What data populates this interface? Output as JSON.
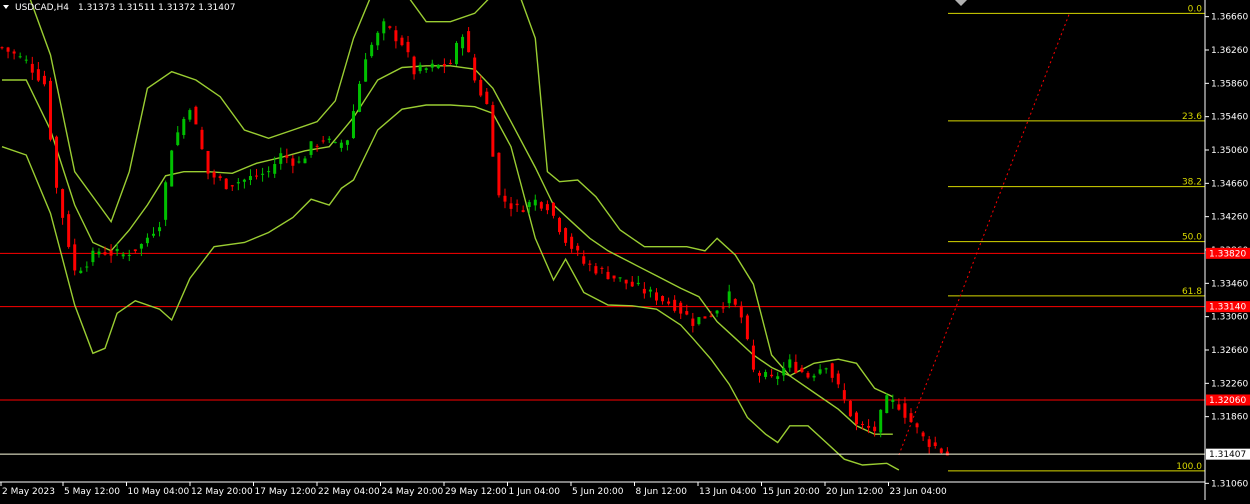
{
  "header": {
    "symbol_text": "USDCAD,H4",
    "ohlc_text": "1.31373 1.31511 1.31372 1.31407"
  },
  "colors": {
    "background": "#000000",
    "bull": "#00c000",
    "bear": "#ff0000",
    "band": "#9acd32",
    "fib": "#d8d800",
    "resistance_line": "#ff0000",
    "current_price_line": "#ffffe0",
    "price_tag_red": "#ff0000",
    "projection": "#ff0000",
    "axis_text": "#ffffff",
    "price_tag_current_bg": "#ffffff"
  },
  "chart_data": {
    "type": "candlestick",
    "y_range": [
      1.3086,
      1.3686
    ],
    "y_ticks": [
      "1.36660",
      "1.36260",
      "1.35860",
      "1.35460",
      "1.35060",
      "1.34660",
      "1.34260",
      "1.33860",
      "1.33460",
      "1.33060",
      "1.32660",
      "1.32260",
      "1.31860",
      "1.31060"
    ],
    "x_labels": [
      "2 May 2023",
      "5 May 12:00",
      "10 May 04:00",
      "12 May 20:00",
      "17 May 12:00",
      "22 May 04:00",
      "24 May 20:00",
      "29 May 12:00",
      "1 Jun 04:00",
      "5 Jun 20:00",
      "8 Jun 12:00",
      "13 Jun 04:00",
      "15 Jun 20:00",
      "20 Jun 12:00",
      "23 Jun 04:00"
    ],
    "close_path": [
      [
        0,
        1.3629
      ],
      [
        4,
        1.3612
      ],
      [
        7,
        1.3586
      ],
      [
        9,
        1.346
      ],
      [
        12,
        1.336
      ],
      [
        16,
        1.3385
      ],
      [
        20,
        1.338
      ],
      [
        23,
        1.3392
      ],
      [
        26,
        1.342
      ],
      [
        28,
        1.351
      ],
      [
        31,
        1.356
      ],
      [
        34,
        1.3478
      ],
      [
        37,
        1.3465
      ],
      [
        40,
        1.347
      ],
      [
        44,
        1.348
      ],
      [
        46,
        1.35
      ],
      [
        49,
        1.349
      ],
      [
        51,
        1.351
      ],
      [
        53,
        1.352
      ],
      [
        55,
        1.351
      ],
      [
        57,
        1.352
      ],
      [
        60,
        1.362
      ],
      [
        63,
        1.3655
      ],
      [
        66,
        1.3635
      ],
      [
        68,
        1.36
      ],
      [
        71,
        1.3605
      ],
      [
        74,
        1.361
      ],
      [
        76,
        1.3648
      ],
      [
        78,
        1.359
      ],
      [
        80,
        1.356
      ],
      [
        82,
        1.345
      ],
      [
        85,
        1.3435
      ],
      [
        88,
        1.3445
      ],
      [
        90,
        1.344
      ],
      [
        93,
        1.34
      ],
      [
        96,
        1.337
      ],
      [
        99,
        1.336
      ],
      [
        102,
        1.335
      ],
      [
        105,
        1.334
      ],
      [
        108,
        1.333
      ],
      [
        111,
        1.332
      ],
      [
        114,
        1.33
      ],
      [
        117,
        1.331
      ],
      [
        120,
        1.333
      ],
      [
        122,
        1.3305
      ],
      [
        124,
        1.324
      ],
      [
        127,
        1.323
      ],
      [
        130,
        1.325
      ],
      [
        133,
        1.3235
      ],
      [
        136,
        1.325
      ],
      [
        138,
        1.322
      ],
      [
        141,
        1.3175
      ],
      [
        144,
        1.317
      ],
      [
        146,
        1.3205
      ],
      [
        148,
        1.32
      ],
      [
        150,
        1.318
      ],
      [
        152,
        1.316
      ],
      [
        154,
        1.315
      ],
      [
        156,
        1.3141
      ]
    ],
    "bollinger": {
      "upper": [
        [
          0,
          1.37
        ],
        [
          4,
          1.37
        ],
        [
          8,
          1.362
        ],
        [
          12,
          1.348
        ],
        [
          16,
          1.344
        ],
        [
          18,
          1.342
        ],
        [
          21,
          1.348
        ],
        [
          24,
          1.358
        ],
        [
          28,
          1.36
        ],
        [
          32,
          1.359
        ],
        [
          36,
          1.357
        ],
        [
          40,
          1.353
        ],
        [
          44,
          1.352
        ],
        [
          48,
          1.353
        ],
        [
          52,
          1.354
        ],
        [
          55,
          1.3565
        ],
        [
          58,
          1.364
        ],
        [
          62,
          1.371
        ],
        [
          66,
          1.37
        ],
        [
          70,
          1.366
        ],
        [
          74,
          1.366
        ],
        [
          78,
          1.367
        ],
        [
          82,
          1.37
        ],
        [
          85,
          1.37
        ],
        [
          88,
          1.364
        ],
        [
          90,
          1.348
        ],
        [
          92,
          1.3468
        ],
        [
          95,
          1.347
        ],
        [
          98,
          1.345
        ],
        [
          102,
          1.341
        ],
        [
          106,
          1.339
        ],
        [
          110,
          1.339
        ],
        [
          113,
          1.339
        ],
        [
          116,
          1.3385
        ],
        [
          118,
          1.34
        ],
        [
          121,
          1.338
        ],
        [
          124,
          1.3345
        ],
        [
          127,
          1.326
        ],
        [
          130,
          1.3235
        ],
        [
          134,
          1.325
        ],
        [
          138,
          1.3255
        ],
        [
          141,
          1.325
        ],
        [
          144,
          1.322
        ],
        [
          147,
          1.321
        ]
      ],
      "middle": [
        [
          0,
          1.359
        ],
        [
          4,
          1.359
        ],
        [
          8,
          1.353
        ],
        [
          12,
          1.344
        ],
        [
          15,
          1.3395
        ],
        [
          18,
          1.3385
        ],
        [
          21,
          1.341
        ],
        [
          24,
          1.344
        ],
        [
          27,
          1.3475
        ],
        [
          30,
          1.348
        ],
        [
          34,
          1.348
        ],
        [
          38,
          1.3478
        ],
        [
          42,
          1.349
        ],
        [
          46,
          1.3497
        ],
        [
          50,
          1.3505
        ],
        [
          54,
          1.351
        ],
        [
          58,
          1.3545
        ],
        [
          62,
          1.359
        ],
        [
          66,
          1.3605
        ],
        [
          70,
          1.3607
        ],
        [
          74,
          1.3607
        ],
        [
          78,
          1.3603
        ],
        [
          81,
          1.358
        ],
        [
          84,
          1.354
        ],
        [
          88,
          1.3485
        ],
        [
          91,
          1.344
        ],
        [
          94,
          1.342
        ],
        [
          97,
          1.34
        ],
        [
          100,
          1.3385
        ],
        [
          104,
          1.337
        ],
        [
          108,
          1.3355
        ],
        [
          112,
          1.334
        ],
        [
          115,
          1.333
        ],
        [
          118,
          1.33
        ],
        [
          121,
          1.328
        ],
        [
          124,
          1.326
        ],
        [
          127,
          1.3245
        ],
        [
          130,
          1.3235
        ],
        [
          134,
          1.3215
        ],
        [
          138,
          1.3195
        ],
        [
          141,
          1.3175
        ],
        [
          144,
          1.3165
        ],
        [
          147,
          1.3165
        ]
      ],
      "lower": [
        [
          0,
          1.351
        ],
        [
          4,
          1.35
        ],
        [
          8,
          1.343
        ],
        [
          12,
          1.332
        ],
        [
          15,
          1.3262
        ],
        [
          17,
          1.3268
        ],
        [
          19,
          1.331
        ],
        [
          22,
          1.3325
        ],
        [
          26,
          1.3315
        ],
        [
          28,
          1.3302
        ],
        [
          31,
          1.3352
        ],
        [
          35,
          1.339
        ],
        [
          40,
          1.3395
        ],
        [
          44,
          1.3407
        ],
        [
          48,
          1.3425
        ],
        [
          51,
          1.3447
        ],
        [
          54,
          1.344
        ],
        [
          56,
          1.346
        ],
        [
          58,
          1.347
        ],
        [
          62,
          1.353
        ],
        [
          66,
          1.3555
        ],
        [
          70,
          1.356
        ],
        [
          74,
          1.356
        ],
        [
          78,
          1.3558
        ],
        [
          81,
          1.355
        ],
        [
          84,
          1.351
        ],
        [
          88,
          1.34
        ],
        [
          91,
          1.335
        ],
        [
          93,
          1.3375
        ],
        [
          96,
          1.3335
        ],
        [
          100,
          1.332
        ],
        [
          104,
          1.3319
        ],
        [
          108,
          1.3315
        ],
        [
          112,
          1.3296
        ],
        [
          114,
          1.328
        ],
        [
          117,
          1.3255
        ],
        [
          120,
          1.3225
        ],
        [
          123,
          1.3185
        ],
        [
          126,
          1.3165
        ],
        [
          128,
          1.3155
        ],
        [
          130,
          1.3175
        ],
        [
          133,
          1.3175
        ],
        [
          136,
          1.3155
        ],
        [
          139,
          1.3135
        ],
        [
          142,
          1.3128
        ],
        [
          146,
          1.313
        ],
        [
          148,
          1.3122
        ]
      ]
    },
    "fibonacci": {
      "levels": [
        {
          "label": "0.0",
          "price": 1.367
        },
        {
          "label": "23.6",
          "price": 1.3541
        },
        {
          "label": "38.2",
          "price": 1.3462
        },
        {
          "label": "50.0",
          "price": 1.3396
        },
        {
          "label": "61.8",
          "price": 1.3331
        },
        {
          "label": "100.0",
          "price": 1.3121
        }
      ]
    },
    "resistance_levels": [
      {
        "price": 1.3382,
        "label": "1.33820"
      },
      {
        "price": 1.3318,
        "label": "1.33140"
      },
      {
        "price": 1.3206,
        "label": "1.32060"
      }
    ],
    "current_price": {
      "price": 1.3141,
      "label": "1.31407"
    },
    "projection": {
      "from": [
        148,
        1.314
      ],
      "to": [
        158,
        1.367
      ]
    }
  }
}
